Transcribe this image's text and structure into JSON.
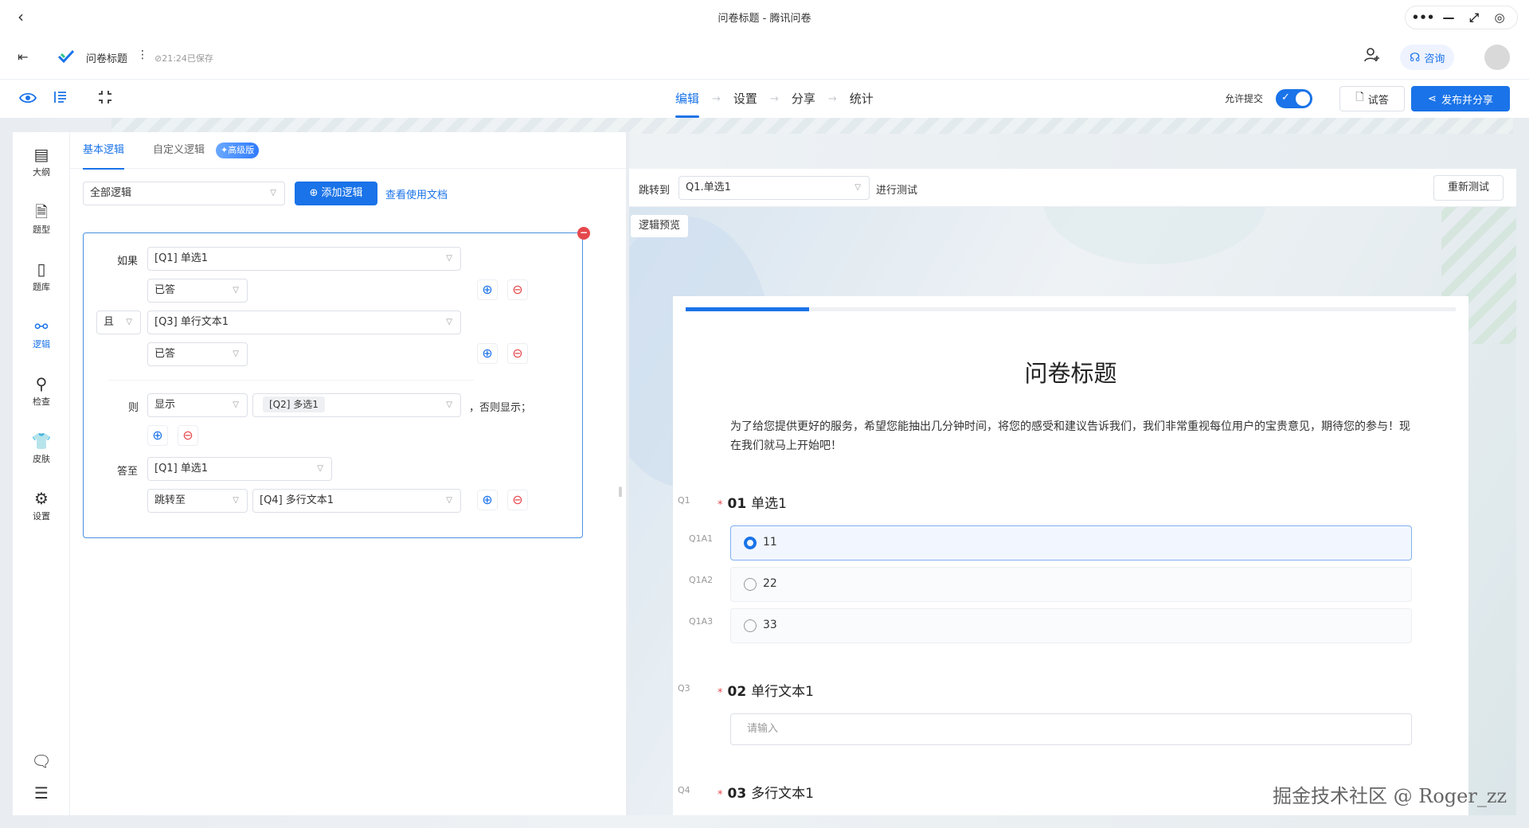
{
  "window": {
    "title": "问卷标题 - 腾讯问卷",
    "back_icon": "‹",
    "controls": [
      "•••",
      "—",
      "⤢",
      "◎"
    ]
  },
  "header": {
    "exit_icon": "⇤",
    "title": "问卷标题",
    "menu_icon": "⋮",
    "saved": "⊘21:24已保存",
    "consult_label": "咨询"
  },
  "toolbar": {
    "steps": [
      "编辑",
      "设置",
      "分享",
      "统计"
    ],
    "active_step": "编辑",
    "allow_submit_label": "允许提交",
    "allow_submit": true,
    "try_label": "试答",
    "publish_label": "发布并分享"
  },
  "left_nav": [
    {
      "label": "大纲",
      "icon": "outline-icon"
    },
    {
      "label": "题型",
      "icon": "question-type-icon"
    },
    {
      "label": "题库",
      "icon": "question-bank-icon"
    },
    {
      "label": "逻辑",
      "icon": "logic-icon",
      "active": true
    },
    {
      "label": "检查",
      "icon": "check-icon"
    },
    {
      "label": "皮肤",
      "icon": "skin-icon"
    },
    {
      "label": "设置",
      "icon": "settings-icon"
    }
  ],
  "logic": {
    "tabs": [
      "基本逻辑",
      "自定义逻辑"
    ],
    "pro_badge": "✦高级版",
    "filter_value": "全部逻辑",
    "add_label": "添加逻辑",
    "doc_link": "查看使用文档",
    "rule": {
      "if_label": "如果",
      "cond1_question": "[Q1] 单选1",
      "cond1_state": "已答",
      "and_label": "且",
      "cond2_question": "[Q3] 单行文本1",
      "cond2_state": "已答",
      "then_label": "则",
      "then_action": "显示",
      "then_target": "[Q2] 多选1",
      "else_label": "，否则显示；",
      "answer_label": "答至",
      "answer_question": "[Q1] 单选1",
      "jump_action": "跳转至",
      "jump_target": "[Q4] 多行文本1"
    }
  },
  "test_bar": {
    "jump_label": "跳转到",
    "jump_value": "Q1.单选1",
    "run_label": "进行测试",
    "retest_label": "重新测试",
    "preview_tag": "逻辑预览"
  },
  "survey": {
    "progress": 0.16,
    "title": "问卷标题",
    "description": "为了给您提供更好的服务，希望您能抽出几分钟时间，将您的感受和建议告诉我们，我们非常重视每位用户的宝贵意见，期待您的参与！现在我们就马上开始吧！",
    "q1": {
      "code": "Q1",
      "no": "01",
      "title": "单选1",
      "options": [
        {
          "code": "Q1A1",
          "text": "11",
          "selected": true
        },
        {
          "code": "Q1A2",
          "text": "22",
          "selected": false
        },
        {
          "code": "Q1A3",
          "text": "33",
          "selected": false
        }
      ]
    },
    "q2": {
      "code": "Q3",
      "no": "02",
      "title": "单行文本1",
      "placeholder": "请输入"
    },
    "q3": {
      "code": "Q4",
      "no": "03",
      "title": "多行文本1"
    }
  },
  "watermark": "掘金技术社区 @ Roger_zz",
  "colors": {
    "accent": "#1a73e8",
    "danger": "#e5484d"
  }
}
